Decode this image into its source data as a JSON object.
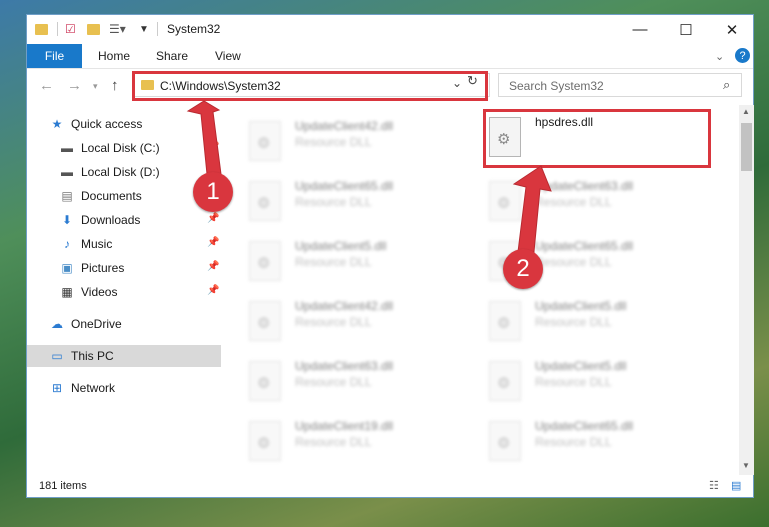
{
  "window": {
    "title": "System32"
  },
  "ribbon": {
    "tabs": [
      "File",
      "Home",
      "Share",
      "View"
    ]
  },
  "address": {
    "path": "C:\\Windows\\System32"
  },
  "search": {
    "placeholder": "Search System32"
  },
  "sidebar": {
    "items": [
      {
        "label": "Quick access",
        "icon": "star-icon"
      },
      {
        "label": "Local Disk (C:)",
        "icon": "drive-icon"
      },
      {
        "label": "Local Disk (D:)",
        "icon": "drive-icon"
      },
      {
        "label": "Documents",
        "icon": "documents-icon"
      },
      {
        "label": "Downloads",
        "icon": "download-icon"
      },
      {
        "label": "Music",
        "icon": "music-icon"
      },
      {
        "label": "Pictures",
        "icon": "pictures-icon"
      },
      {
        "label": "Videos",
        "icon": "videos-icon"
      },
      {
        "label": "OneDrive",
        "icon": "cloud-icon"
      },
      {
        "label": "This PC",
        "icon": "computer-icon"
      },
      {
        "label": "Network",
        "icon": "network-icon"
      }
    ]
  },
  "files": {
    "highlighted": {
      "name": "hpsdres.dll"
    },
    "left_column": [
      {
        "name": "UpdateClient42.dll",
        "type": "Resource DLL"
      },
      {
        "name": "UpdateClient65.dll",
        "type": "Resource DLL"
      },
      {
        "name": "UpdateClient5.dll",
        "type": "Resource DLL"
      },
      {
        "name": "UpdateClient42.dll",
        "type": "Resource DLL"
      },
      {
        "name": "UpdateClient63.dll",
        "type": "Resource DLL"
      },
      {
        "name": "UpdateClient19.dll",
        "type": "Resource DLL"
      }
    ],
    "right_column": [
      {
        "name": "UpdateClient63.dll",
        "type": "Resource DLL"
      },
      {
        "name": "UpdateClient65.dll",
        "type": "Resource DLL"
      },
      {
        "name": "UpdateClient5.dll",
        "type": "Resource DLL"
      },
      {
        "name": "UpdateClient5.dll",
        "type": "Resource DLL"
      },
      {
        "name": "UpdateClient65.dll",
        "type": "Resource DLL"
      }
    ]
  },
  "status": {
    "count": "181 items"
  },
  "annotations": {
    "step1": "1",
    "step2": "2",
    "color": "#d9363e"
  }
}
